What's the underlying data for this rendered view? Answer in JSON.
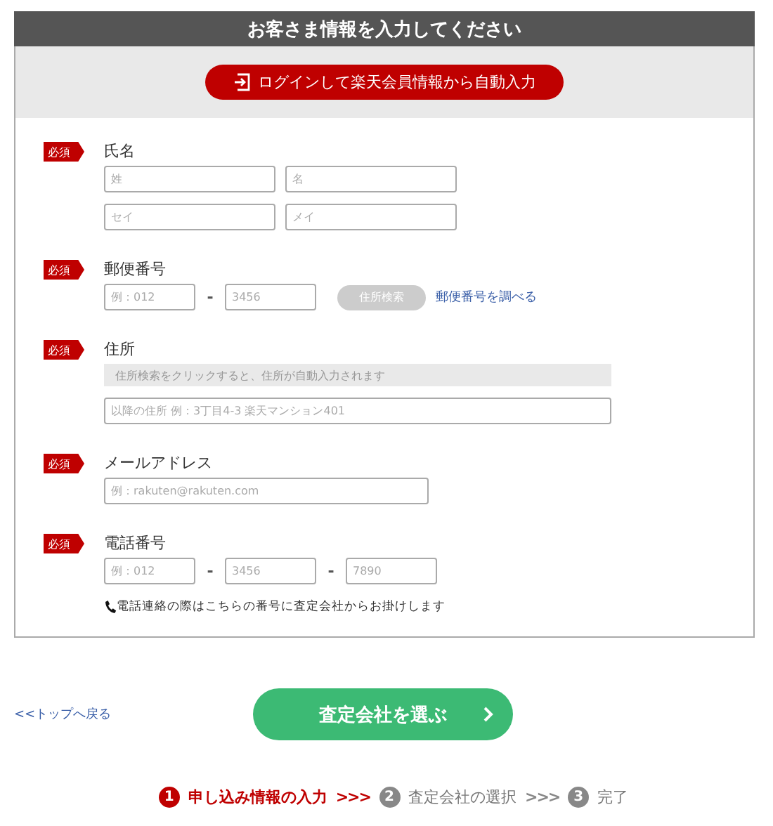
{
  "panel": {
    "title": "お客さま情報を入力してください",
    "login_button": "ログインして楽天会員情報から自動入力"
  },
  "sections": [
    {
      "badge": "必須",
      "label": "氏名",
      "rows": [
        {
          "kind": "name",
          "items": [
            {
              "kind": "input",
              "placeholder": "姓"
            },
            {
              "kind": "input",
              "placeholder": "名"
            }
          ]
        },
        {
          "kind": "name",
          "items": [
            {
              "kind": "input",
              "placeholder": "セイ"
            },
            {
              "kind": "input",
              "placeholder": "メイ"
            }
          ]
        }
      ]
    },
    {
      "badge": "必須",
      "label": "郵便番号",
      "rows": [
        {
          "kind": "zip",
          "items": [
            {
              "kind": "input",
              "placeholder": "例：012"
            },
            {
              "kind": "dash",
              "text": "-"
            },
            {
              "kind": "input",
              "placeholder": "3456"
            },
            {
              "kind": "button",
              "text": "住所検索",
              "disabled": true
            },
            {
              "kind": "link",
              "text": "郵便番号を調べる"
            }
          ]
        }
      ]
    },
    {
      "badge": "必須",
      "label": "住所",
      "rows": [
        {
          "kind": "address",
          "items": [
            {
              "kind": "hint",
              "text": "住所検索をクリックすると、住所が自動入力されます"
            }
          ]
        },
        {
          "kind": "address",
          "items": [
            {
              "kind": "input",
              "placeholder": "以降の住所 例：3丁目4-3 楽天マンション401"
            }
          ]
        }
      ]
    },
    {
      "badge": "必須",
      "label": "メールアドレス",
      "rows": [
        {
          "kind": "email",
          "items": [
            {
              "kind": "input",
              "placeholder": "例：rakuten@rakuten.com"
            }
          ]
        }
      ]
    },
    {
      "badge": "必須",
      "label": "電話番号",
      "rows": [
        {
          "kind": "zip",
          "items": [
            {
              "kind": "input",
              "placeholder": "例：012"
            },
            {
              "kind": "dash",
              "text": "-"
            },
            {
              "kind": "input",
              "placeholder": "3456"
            },
            {
              "kind": "dash",
              "text": "-"
            },
            {
              "kind": "input",
              "placeholder": "7890"
            }
          ]
        },
        {
          "kind": "note",
          "items": [
            {
              "kind": "note",
              "text": "電話連絡の際はこちらの番号に査定会社からお掛けします"
            }
          ]
        }
      ]
    }
  ],
  "back_link": "<<トップへ戻る",
  "submit_button": "査定会社を選ぶ",
  "steps": [
    {
      "number": "1",
      "label": "申し込み情報の入力",
      "selected": true
    },
    {
      "number": "2",
      "label": "査定会社の選択",
      "selected": false
    },
    {
      "number": "3",
      "label": "完了",
      "selected": false
    }
  ],
  "step_separators": [
    ">>>",
    ">>>"
  ]
}
